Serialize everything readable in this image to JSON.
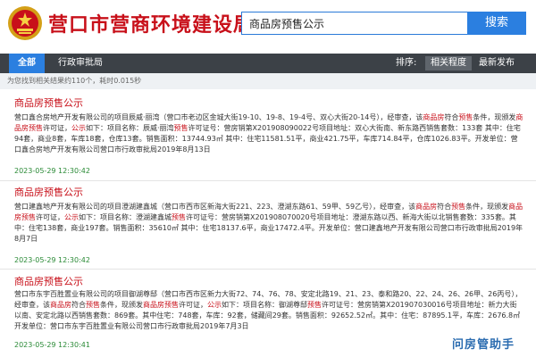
{
  "header": {
    "site_title": "营口市营商环境建设局",
    "search_value": "商品房预售公示",
    "search_button": "搜索"
  },
  "nav": {
    "tabs": [
      "全部",
      "行政审批局"
    ],
    "sort_label": "排序:",
    "sort_options": [
      "相关程度",
      "最新发布"
    ]
  },
  "result_summary": "为您找到相关结果约110个，耗时0.015秒",
  "items": [
    {
      "title": "商品房预售公示",
      "body": [
        {
          "t": "营口鑫合房地产开发有限公司的项目辰威·丽湾（营口市老边区金城大街19-10、19-8、19-4号、双心大街20-14号），经审查，该"
        },
        {
          "t": "商品房",
          "h": true
        },
        {
          "t": "符合"
        },
        {
          "t": "预售",
          "h": true
        },
        {
          "t": "条件，现颁发"
        },
        {
          "t": "商品房预售",
          "h": true
        },
        {
          "t": "许可证，"
        },
        {
          "t": "公示",
          "h": true
        },
        {
          "t": "如下：项目名称：辰威·丽湾"
        },
        {
          "t": "预售",
          "h": true
        },
        {
          "t": "许可证号：营房销第X201908090022号项目地址：双心大街南、新东路西销售套数：133套 其中：住宅94套，商业8套，车库18套，仓库13套。销售面积：13744.93㎡ 其中：住宅11581.51平，商业421.75平，车库714.84平，仓库1026.83平。开发单位：营口鑫合房地产开发有限公司营口市行政审批局2019年8月13日"
        }
      ],
      "date": "2023-05-29 12:30:42"
    },
    {
      "title": "商品房预售公示",
      "body": [
        {
          "t": "营口建鑫地产开发有限公司的项目澄湖建鑫城（营口市西市区新海大街221、223、澄湖东路61、59甲、59乙号），经审查，该"
        },
        {
          "t": "商品房",
          "h": true
        },
        {
          "t": "符合"
        },
        {
          "t": "预售",
          "h": true
        },
        {
          "t": "条件，现颁发"
        },
        {
          "t": "商品房预售",
          "h": true
        },
        {
          "t": "许可证，"
        },
        {
          "t": "公示",
          "h": true
        },
        {
          "t": "如下：项目名称：澄湖建鑫城"
        },
        {
          "t": "预售",
          "h": true
        },
        {
          "t": "许可证号：营房销第X201908070020号项目地址：澄湖东路以西、新海大街以北销售套数：335套。其中：住宅138套，商业197套。销售面积：35610㎡ 其中：住宅18137.6平，商业17472.4平。开发单位：营口建鑫地产开发有限公司营口市行政审批局2019年8月7日"
        }
      ],
      "date": "2023-05-29 12:30:42"
    },
    {
      "title": "商品房预售公示",
      "body": [
        {
          "t": "营口市东宇百胜置业有限公司的项目御湖尊邸（营口市西市区新力大街72、74、76、78、安定北路19、21、23、泰和路20、22、24、26、26甲、26丙号），经审查，该"
        },
        {
          "t": "商品房",
          "h": true
        },
        {
          "t": "符合"
        },
        {
          "t": "预售",
          "h": true
        },
        {
          "t": "条件，现颁发"
        },
        {
          "t": "商品房预售",
          "h": true
        },
        {
          "t": "许可证，"
        },
        {
          "t": "公示",
          "h": true
        },
        {
          "t": "如下：项目名称：御湖尊邸"
        },
        {
          "t": "预售",
          "h": true
        },
        {
          "t": "许可证号：营房销第X201907030016号项目地址：新力大街以南、安定北路以西销售套数：869套。其中住宅：748套，车库：92套，储藏间29套。销售面积：92652.52㎡。其中：住宅：87895.1平，车库：2676.8㎡ 开发单位：营口市东宇百胜置业有限公司营口市行政审批局2019年7月3日"
        }
      ],
      "date": "2023-05-29 12:30:41"
    }
  ],
  "watermark": "问房管助手"
}
